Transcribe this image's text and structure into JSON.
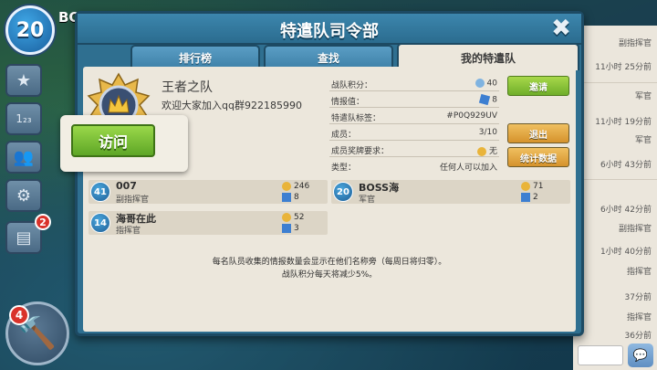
{
  "player": {
    "level": "20",
    "name": "BO"
  },
  "side_notifications": "2",
  "builder": {
    "count": "4"
  },
  "chat": {
    "rows": [
      {
        "text": "副指挥官"
      },
      {
        "text": "11小时 25分前"
      },
      {
        "text": "军官"
      },
      {
        "text": "11小时 19分前"
      },
      {
        "text": "军官"
      },
      {
        "text": "6小时 43分前"
      },
      {
        "text": "6小时 42分前"
      },
      {
        "text": "副指挥官"
      },
      {
        "text": "1小时 40分前"
      },
      {
        "text": "指挥官"
      },
      {
        "text": "37分前"
      },
      {
        "text": "指挥官"
      },
      {
        "text": "36分前"
      }
    ]
  },
  "modal": {
    "title": "特遣队司令部",
    "tabs": [
      {
        "label": "排行榜",
        "active": false
      },
      {
        "label": "查找",
        "active": false
      },
      {
        "label": "我的特遣队",
        "active": true
      }
    ]
  },
  "team": {
    "name": "王者之队",
    "description": "欢迎大家加入qq群922185990",
    "stats": [
      {
        "label": "战队积分：",
        "value": "40",
        "icon": "score-icon"
      },
      {
        "label": "情报值：",
        "value": "8",
        "icon": "intel-icon"
      },
      {
        "label": "特遣队标签：",
        "value": "#P0Q929UV",
        "icon": ""
      },
      {
        "label": "成员：",
        "value": "3/10",
        "icon": ""
      },
      {
        "label": "成员奖牌要求：",
        "value": "无",
        "icon": "medal-icon"
      },
      {
        "label": "类型：",
        "value": "任何人可以加入",
        "icon": ""
      }
    ],
    "buttons": {
      "invite": "邀请",
      "leave": "退出",
      "stats": "统计数据"
    }
  },
  "members": [
    {
      "level": "41",
      "name": "007",
      "role": "副指挥官",
      "medals": "246",
      "intel": "8"
    },
    {
      "level": "20",
      "name": "BOSS海",
      "role": "军官",
      "medals": "71",
      "intel": "2"
    },
    {
      "level": "14",
      "name": "海哥在此",
      "role": "指挥官",
      "medals": "52",
      "intel": "3"
    }
  ],
  "footer": {
    "line1": "每名队员收集的情报数量会显示在他们名称旁（每周日将归零）。",
    "line2": "战队积分每天将减少5%。"
  },
  "popup": {
    "visit_label": "访问"
  },
  "colors": {
    "accent_green": "#6fae2a",
    "accent_orange": "#d5922c",
    "panel": "#ece7dc",
    "frame": "#2f6f90"
  }
}
